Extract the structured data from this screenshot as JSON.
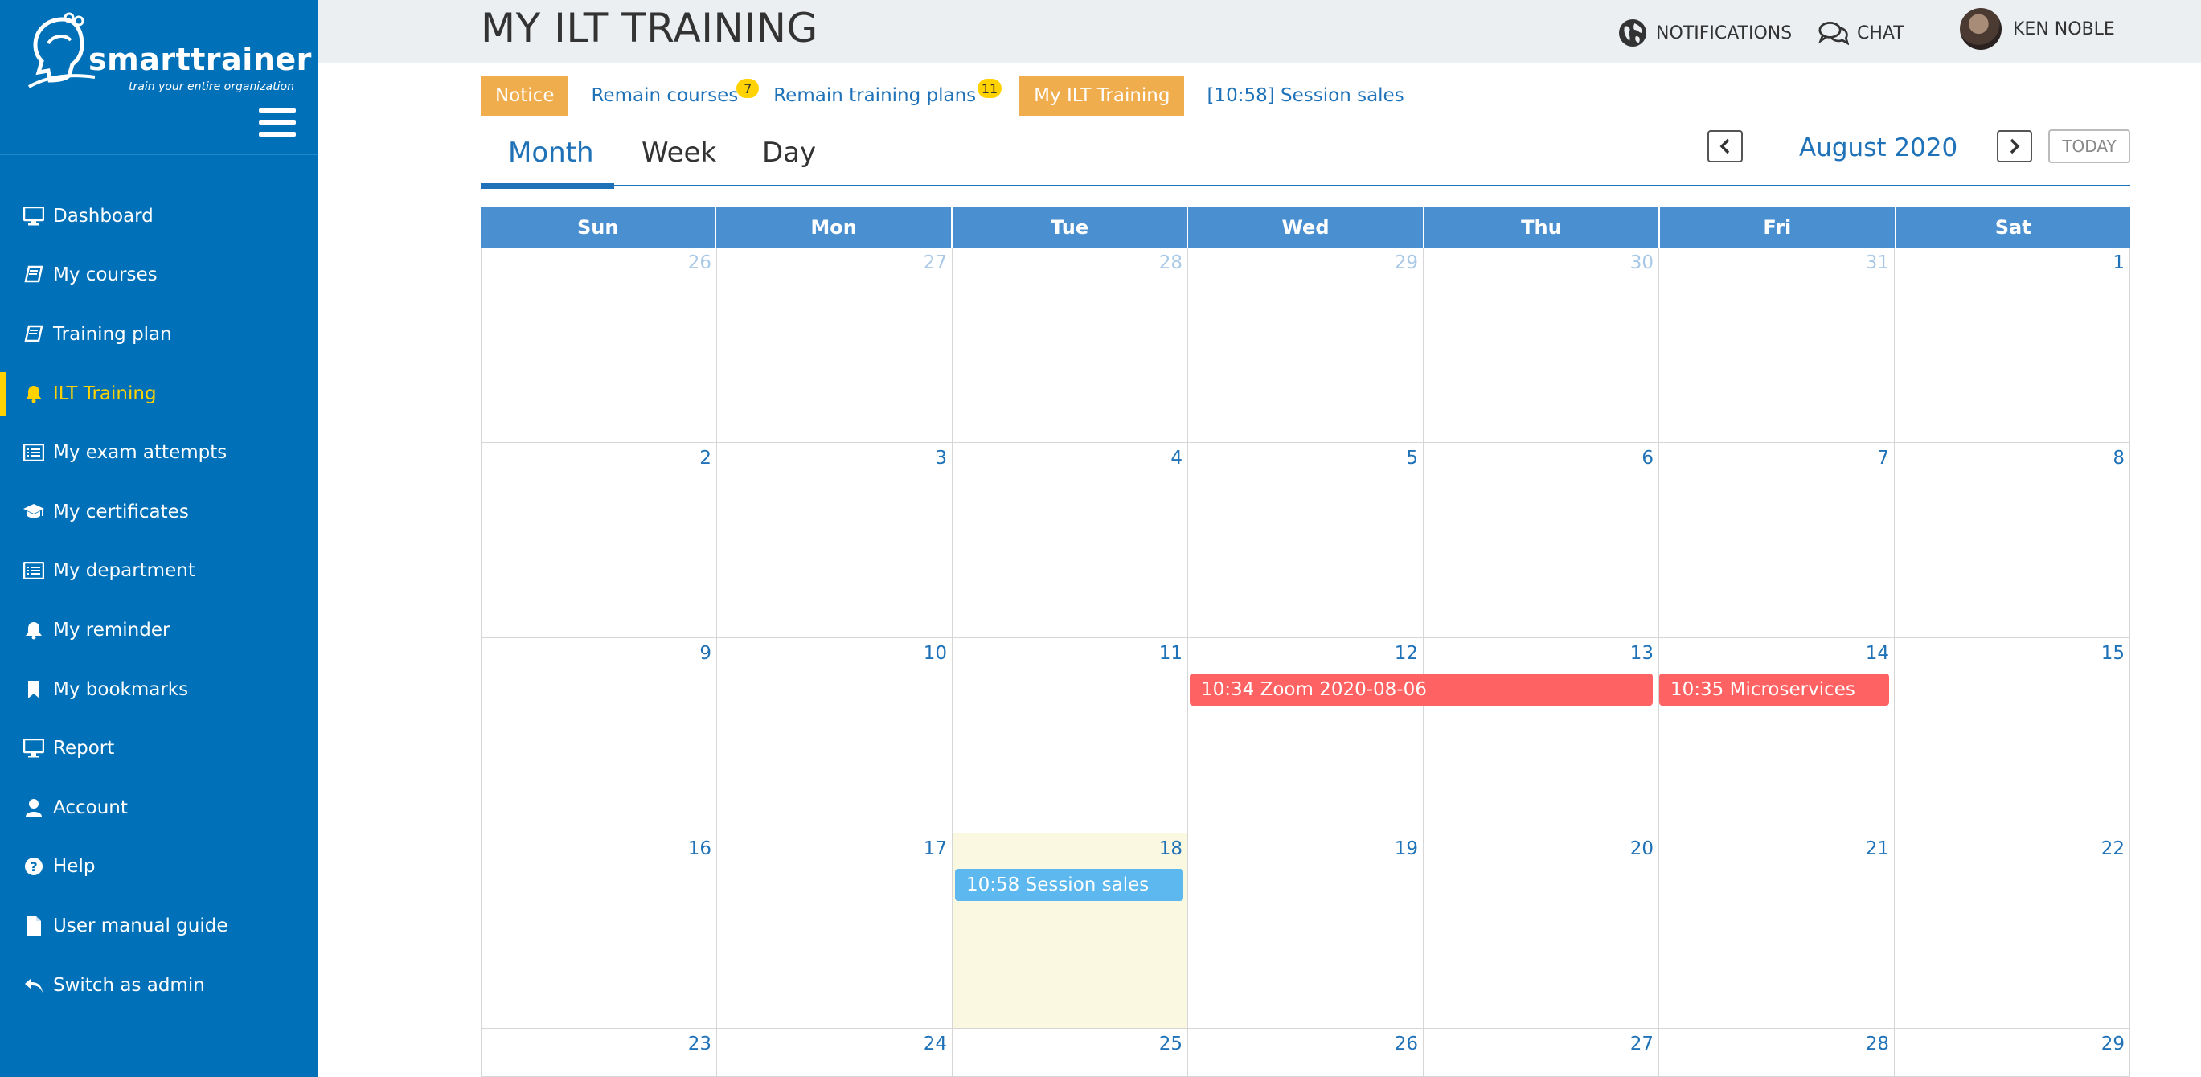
{
  "brand": {
    "name": "smarttrainer",
    "tagline": "train your entire organization"
  },
  "sidebar": {
    "items": [
      {
        "label": "Dashboard",
        "icon": "monitor-icon"
      },
      {
        "label": "My courses",
        "icon": "book-icon"
      },
      {
        "label": "Training plan",
        "icon": "book-icon"
      },
      {
        "label": "ILT Training",
        "icon": "bell-icon",
        "active": true
      },
      {
        "label": "My exam attempts",
        "icon": "list-icon"
      },
      {
        "label": "My certificates",
        "icon": "graduation-cap-icon"
      },
      {
        "label": "My department",
        "icon": "list-icon"
      },
      {
        "label": "My reminder",
        "icon": "bell-icon"
      },
      {
        "label": "My bookmarks",
        "icon": "bookmark-icon"
      },
      {
        "label": "Report",
        "icon": "monitor-icon"
      },
      {
        "label": "Account",
        "icon": "user-icon"
      },
      {
        "label": "Help",
        "icon": "question-circle-icon"
      },
      {
        "label": "User manual guide",
        "icon": "file-icon"
      },
      {
        "label": "Switch as admin",
        "icon": "reply-icon"
      }
    ]
  },
  "header": {
    "title": "MY ILT TRAINING",
    "notifications_label": "NOTIFICATIONS",
    "chat_label": "CHAT",
    "user_name": "KEN NOBLE"
  },
  "subnav": {
    "notice_label": "Notice",
    "remain_courses_label": "Remain courses",
    "remain_courses_count": "7",
    "remain_plans_label": "Remain training plans",
    "remain_plans_count": "11",
    "my_ilt_label": "My ILT Training",
    "session_link": "[10:58] Session sales"
  },
  "calendar": {
    "tabs": [
      "Month",
      "Week",
      "Day"
    ],
    "active_tab": "Month",
    "month_label": "August 2020",
    "today_label": "TODAY",
    "weekdays": [
      "Sun",
      "Mon",
      "Tue",
      "Wed",
      "Thu",
      "Fri",
      "Sat"
    ],
    "weeks": [
      [
        "26",
        "27",
        "28",
        "29",
        "30",
        "31",
        "1"
      ],
      [
        "2",
        "3",
        "4",
        "5",
        "6",
        "7",
        "8"
      ],
      [
        "9",
        "10",
        "11",
        "12",
        "13",
        "14",
        "15"
      ],
      [
        "16",
        "17",
        "18",
        "19",
        "20",
        "21",
        "22"
      ],
      [
        "23",
        "24",
        "25",
        "26",
        "27",
        "28",
        "29"
      ]
    ],
    "events": [
      {
        "label": "10:34 Zoom 2020-08-06",
        "color": "#ff6262"
      },
      {
        "label": "10:35 Microservices",
        "color": "#ff6262"
      },
      {
        "label": "10:58 Session sales",
        "color": "#5cb8ee"
      }
    ]
  },
  "colors": {
    "sidebar_bg": "#0071b8",
    "active_accent": "#ffd200",
    "link": "#1f72b7",
    "chip": "#f0ad4e",
    "calendar_header": "#4a8fd0",
    "today_bg": "#fbf8e2"
  }
}
